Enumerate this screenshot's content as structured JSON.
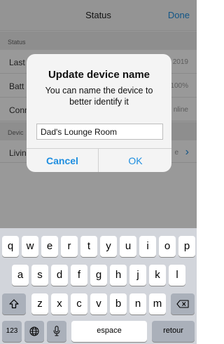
{
  "navbar": {
    "title": "Status",
    "done_label": "Done"
  },
  "status_section": {
    "header": "Status",
    "rows": [
      {
        "label": "Last",
        "value": "2019"
      },
      {
        "label": "Batt",
        "value": "100%"
      },
      {
        "label": "Conn",
        "value": "nline"
      }
    ]
  },
  "device_section": {
    "header": "Devic",
    "row_label": "Livin",
    "row_value": "e"
  },
  "alert": {
    "title": "Update device name",
    "message": "You can name the device to better identify it",
    "input_value": "Dad's Lounge Room",
    "cancel_label": "Cancel",
    "ok_label": "OK"
  },
  "keyboard": {
    "row1": [
      "q",
      "w",
      "e",
      "r",
      "t",
      "y",
      "u",
      "i",
      "o",
      "p"
    ],
    "row2": [
      "a",
      "s",
      "d",
      "f",
      "g",
      "h",
      "j",
      "k",
      "l"
    ],
    "row3": [
      "z",
      "x",
      "c",
      "v",
      "b",
      "n",
      "m"
    ],
    "numbers_label": "123",
    "space_label": "espace",
    "return_label": "retour",
    "shift_icon": "shift-icon",
    "delete_icon": "delete-icon",
    "globe_icon": "globe-icon",
    "mic_icon": "microphone-icon"
  },
  "colors": {
    "accent": "#1e8ee0",
    "keyboard_bg": "#d2d5db"
  }
}
